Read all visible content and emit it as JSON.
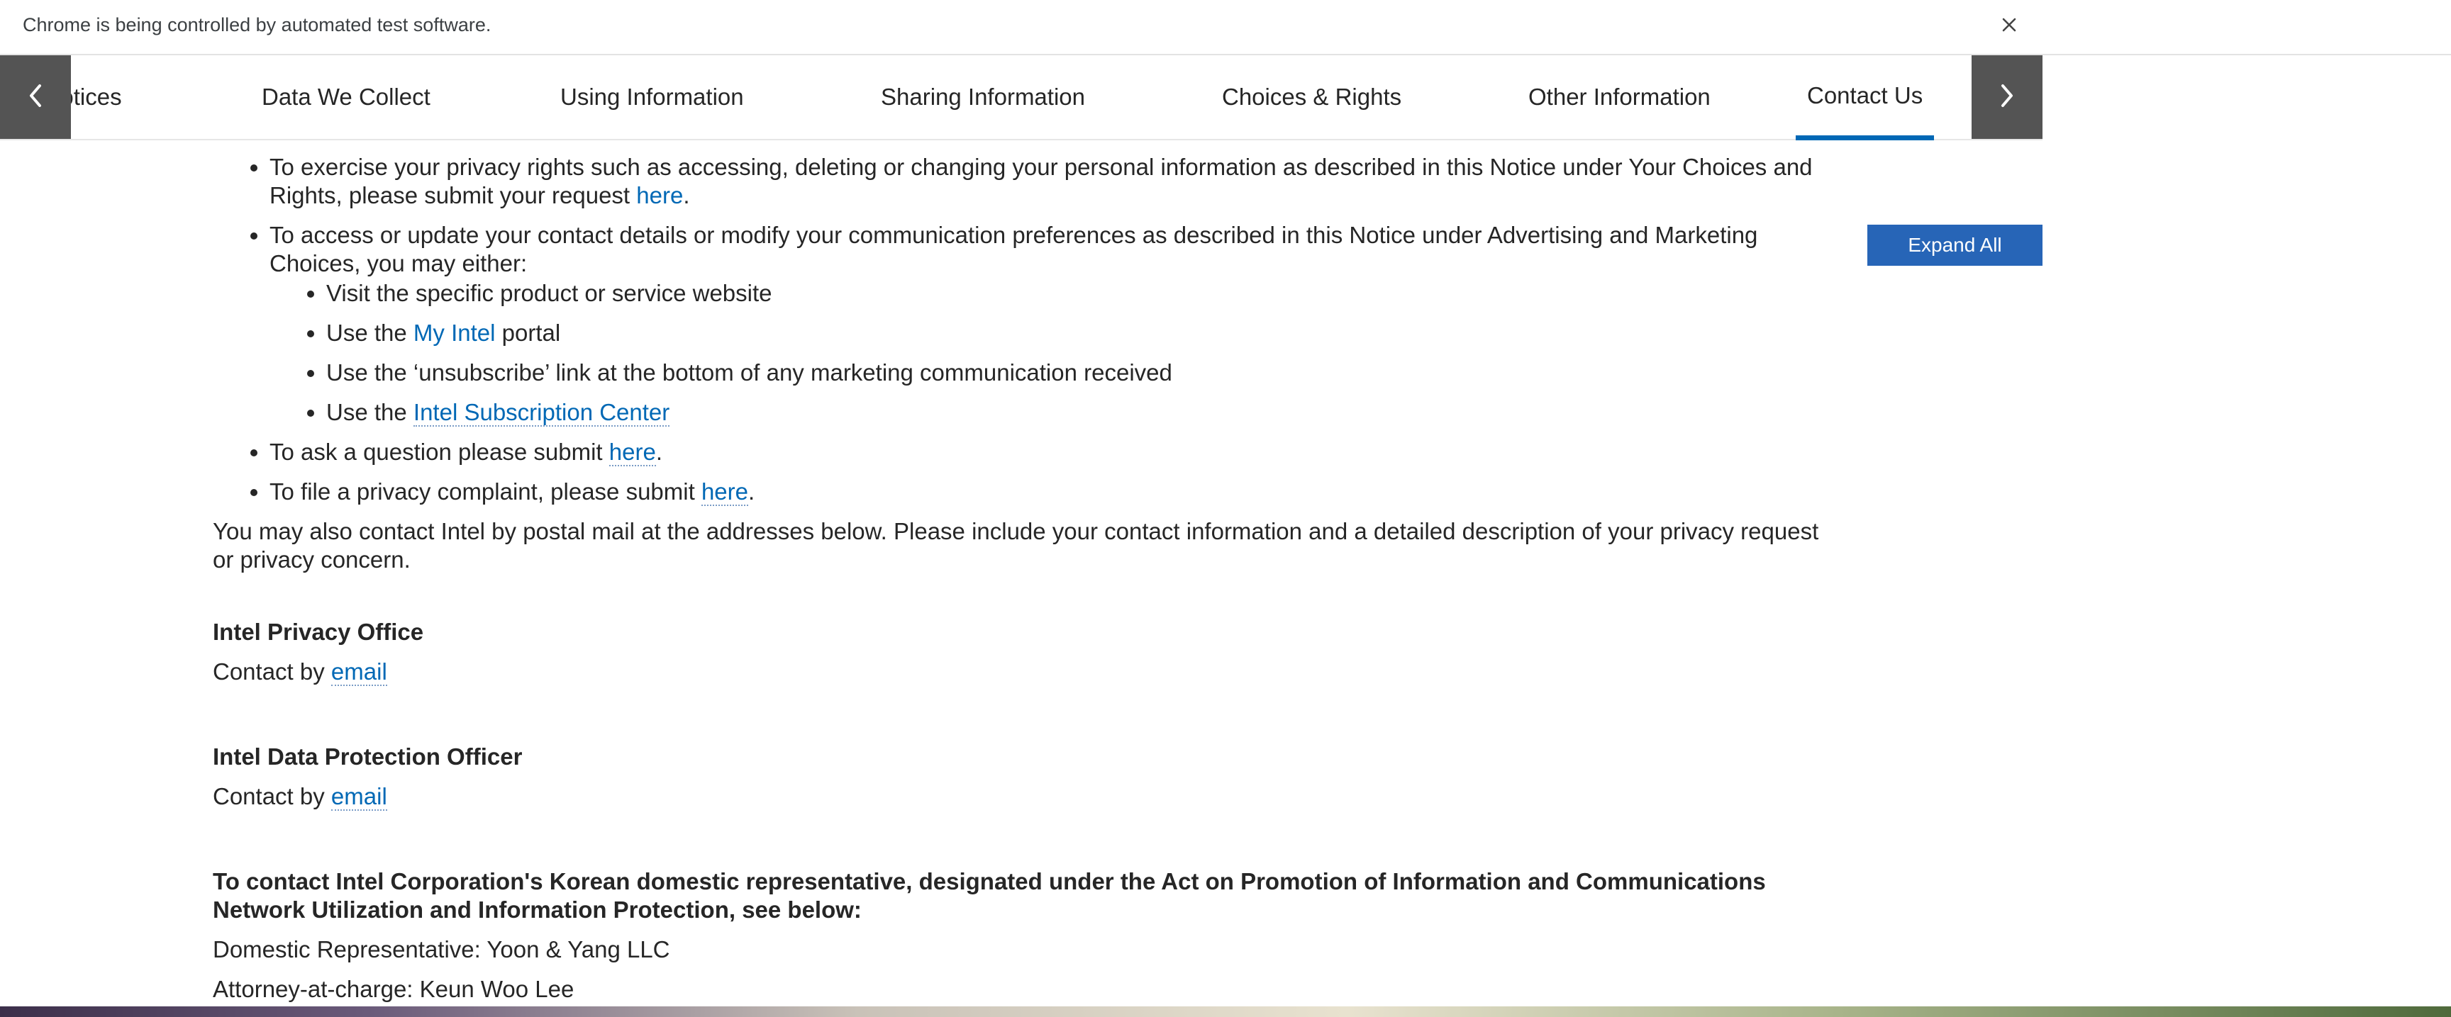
{
  "infobar": {
    "message": "Chrome is being controlled by automated test software."
  },
  "tabs": [
    {
      "label": "onal Notices"
    },
    {
      "label": "Data We Collect"
    },
    {
      "label": "Using Information"
    },
    {
      "label": "Sharing Information"
    },
    {
      "label": "Choices & Rights"
    },
    {
      "label": "Other Information"
    },
    {
      "label": "Contact Us",
      "active": true
    }
  ],
  "expand_all_label": "Expand All",
  "bullets": {
    "exercise_text": "To exercise your privacy rights such as accessing, deleting or changing your personal information as described in this Notice under Your Choices and Rights, please submit your request ",
    "exercise_link": "here",
    "access_text": "To access or update your contact details or modify your communication preferences as described in this Notice under Advertising and Marketing Choices, you may either:",
    "sub": {
      "visit": "Visit the specific product or service website",
      "use_the_1": "Use the ",
      "my_intel_link": "My Intel",
      "portal": " portal",
      "unsubscribe": "Use the ‘unsubscribe’ link at the bottom of any marketing communication received",
      "use_the_2": "Use the ",
      "subscription_link": "Intel Subscription Center"
    },
    "question_text": "To ask a question please submit ",
    "question_link": "here",
    "complaint_text": "To file a privacy complaint, please submit ",
    "complaint_link": "here"
  },
  "postal_paragraph": "You may also contact Intel by postal mail at the addresses below. Please include your contact information and a detailed description of your privacy request or privacy concern.",
  "privacy_office": {
    "heading": "Intel Privacy Office",
    "contact_text": "Contact by ",
    "link": "email"
  },
  "dpo": {
    "heading": "Intel Data Protection Officer",
    "contact_text": "Contact by ",
    "link": "email"
  },
  "korea": {
    "heading": "To contact Intel Corporation's Korean domestic representative, designated under the Act on Promotion of Information and Communications Network Utilization and Information Protection, see below:",
    "representative": "Domestic Representative: Yoon & Yang LLC",
    "attorney": "Attorney-at-charge: Keun Woo Lee"
  }
}
